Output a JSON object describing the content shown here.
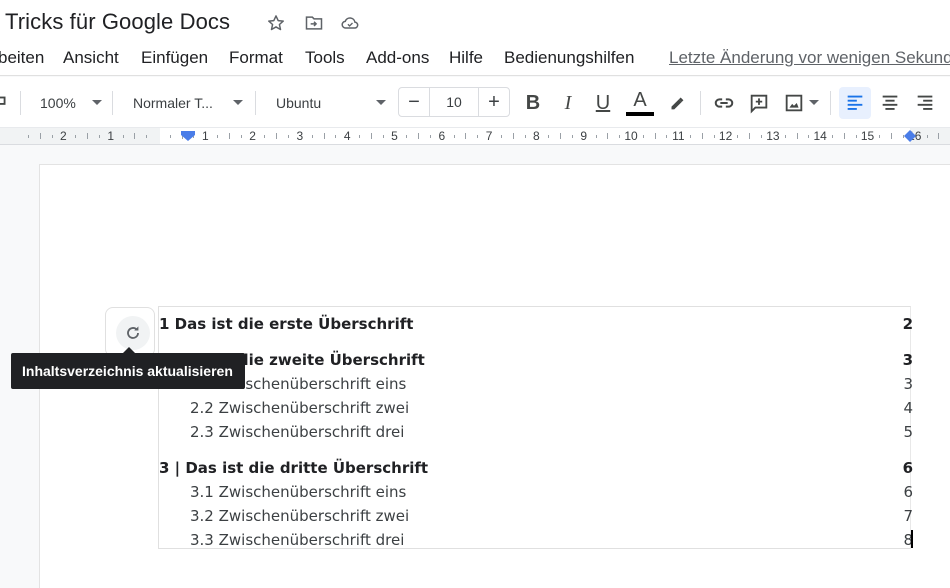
{
  "document": {
    "title": "Tricks für Google Docs"
  },
  "title_icons": [
    {
      "name": "star-icon"
    },
    {
      "name": "move-to-folder-icon"
    },
    {
      "name": "cloud-saved-icon"
    }
  ],
  "menu": {
    "items": [
      "beiten",
      "Ansicht",
      "Einfügen",
      "Format",
      "Tools",
      "Add-ons",
      "Hilfe",
      "Bedienungshilfen"
    ],
    "last_edit": "Letzte Änderung vor wenigen Sekunden"
  },
  "toolbar": {
    "zoom": "100%",
    "style": "Normaler T...",
    "font": "Ubuntu",
    "font_size": "10",
    "minus": "−",
    "plus": "+",
    "bold": "B",
    "italic": "I",
    "underline": "U",
    "text_color": "A",
    "text_color_value": "#000000",
    "alignment_active": "left"
  },
  "ruler": {
    "left_labels": [
      "2",
      "1"
    ],
    "right_labels": [
      "1",
      "2",
      "3",
      "4",
      "5",
      "6",
      "7",
      "8",
      "9",
      "10",
      "11",
      "12",
      "13",
      "14",
      "15",
      "16"
    ]
  },
  "toc": {
    "refresh_tooltip": "Inhaltsverzeichnis aktualisieren",
    "entries": [
      {
        "level": 1,
        "text": "1 Das ist die erste Überschrift",
        "page": "2"
      },
      {
        "level": 1,
        "text": "2 Das ist die zweite Überschrift",
        "page": "3"
      },
      {
        "level": 2,
        "text": "2.1 Zwischenüberschrift eins",
        "page": "3"
      },
      {
        "level": 2,
        "text": "2.2 Zwischenüberschrift zwei",
        "page": "4"
      },
      {
        "level": 2,
        "text": "2.3 Zwischenüberschrift drei",
        "page": "5"
      },
      {
        "level": 1,
        "text": "3 | Das ist die dritte Überschrift",
        "page": "6"
      },
      {
        "level": 2,
        "text": "3.1 Zwischenüberschrift eins",
        "page": "6"
      },
      {
        "level": 2,
        "text": "3.2 Zwischenüberschrift zwei",
        "page": "7"
      },
      {
        "level": 2,
        "text": "3.3 Zwischenüberschrift drei",
        "page": "8"
      }
    ]
  },
  "colors": {
    "accent": "#1a73e8",
    "active_align_bg": "#e8f0fe",
    "tooltip_bg": "#202124"
  }
}
